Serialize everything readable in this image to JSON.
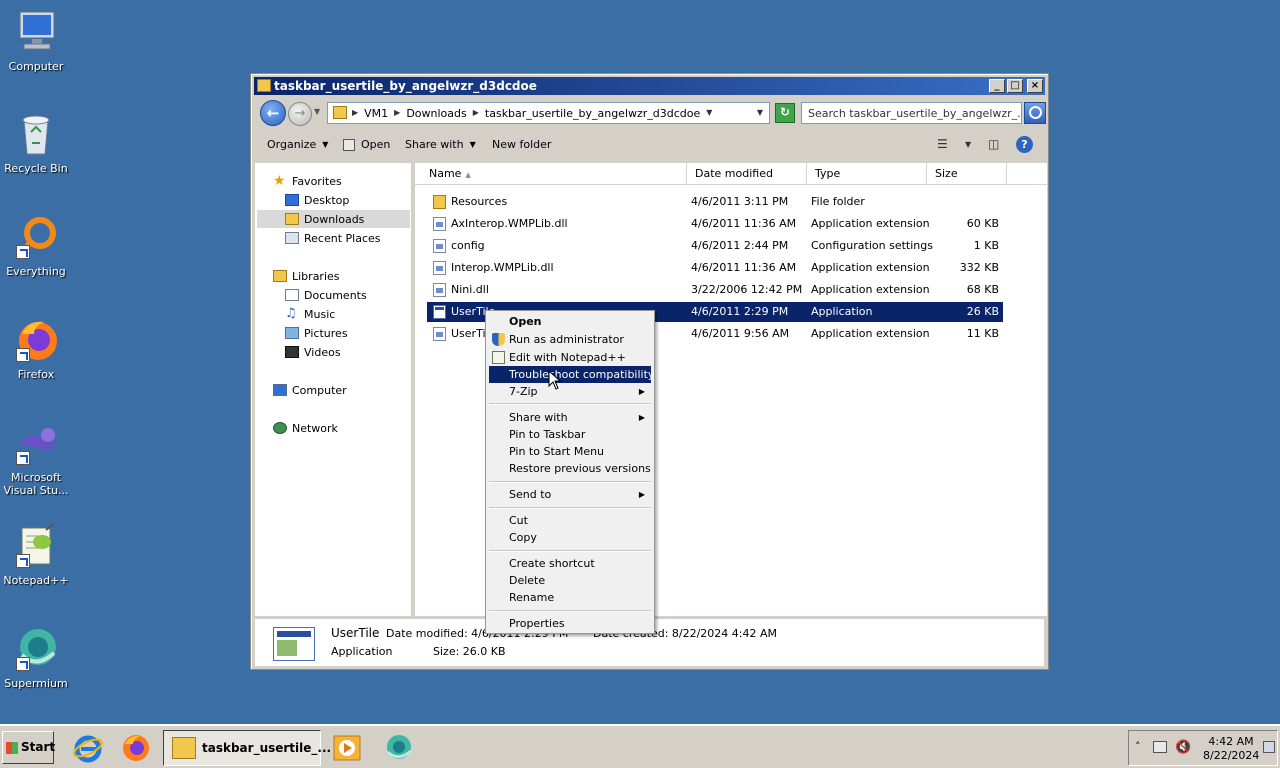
{
  "desktop": {
    "icons": [
      {
        "label": "Computer"
      },
      {
        "label": "Recycle Bin"
      },
      {
        "label": "Everything"
      },
      {
        "label": "Firefox"
      },
      {
        "label": "Microsoft Visual Stu..."
      },
      {
        "label": "Notepad++"
      },
      {
        "label": "Supermium"
      }
    ]
  },
  "window": {
    "title": "taskbar_usertile_by_angelwzr_d3dcdoe",
    "controls": {
      "minimize": "_",
      "maximize": "□",
      "close": "×"
    },
    "address": {
      "crumbs": [
        "VM1",
        "Downloads",
        "taskbar_usertile_by_angelwzr_d3dcdoe"
      ]
    },
    "search": {
      "placeholder": "Search taskbar_usertile_by_angelwzr_..."
    },
    "toolbar": {
      "organize": "Organize",
      "open": "Open",
      "share_with": "Share with",
      "new_folder": "New folder"
    },
    "nav": {
      "favorites": "Favorites",
      "desktop": "Desktop",
      "downloads": "Downloads",
      "recent": "Recent Places",
      "libraries": "Libraries",
      "documents": "Documents",
      "music": "Music",
      "pictures": "Pictures",
      "videos": "Videos",
      "computer": "Computer",
      "network": "Network"
    },
    "columns": {
      "name": "Name",
      "date": "Date modified",
      "type": "Type",
      "size": "Size"
    },
    "files": [
      {
        "name": "Resources",
        "date": "4/6/2011 3:11 PM",
        "type": "File folder",
        "size": ""
      },
      {
        "name": "AxInterop.WMPLib.dll",
        "date": "4/6/2011 11:36 AM",
        "type": "Application extension",
        "size": "60 KB"
      },
      {
        "name": "config",
        "date": "4/6/2011 2:44 PM",
        "type": "Configuration settings",
        "size": "1 KB"
      },
      {
        "name": "Interop.WMPLib.dll",
        "date": "4/6/2011 11:36 AM",
        "type": "Application extension",
        "size": "332 KB"
      },
      {
        "name": "Nini.dll",
        "date": "3/22/2006 12:42 PM",
        "type": "Application extension",
        "size": "68 KB"
      },
      {
        "name": "UserTile",
        "date": "4/6/2011 2:29 PM",
        "type": "Application",
        "size": "26 KB"
      },
      {
        "name": "UserTile",
        "date": "4/6/2011 9:56 AM",
        "type": "Application extension",
        "size": "11 KB"
      }
    ],
    "details": {
      "name": "UserTile",
      "type": "Application",
      "modified": "Date modified: 4/6/2011 2:29 PM",
      "size": "Size: 26.0 KB",
      "created": "Date created: 8/22/2024 4:42 AM"
    }
  },
  "context_menu": {
    "open": "Open",
    "run_admin": "Run as administrator",
    "edit_npp": "Edit with Notepad++",
    "troubleshoot": "Troubleshoot compatibility",
    "zip": "7-Zip",
    "share_with": "Share with",
    "pin_taskbar": "Pin to Taskbar",
    "pin_start": "Pin to Start Menu",
    "restore": "Restore previous versions",
    "send_to": "Send to",
    "cut": "Cut",
    "copy": "Copy",
    "create_shortcut": "Create shortcut",
    "delete": "Delete",
    "rename": "Rename",
    "properties": "Properties"
  },
  "taskbar": {
    "start": "Start",
    "task_label": "taskbar_usertile_...",
    "time": "4:42 AM",
    "date": "8/22/2024"
  }
}
